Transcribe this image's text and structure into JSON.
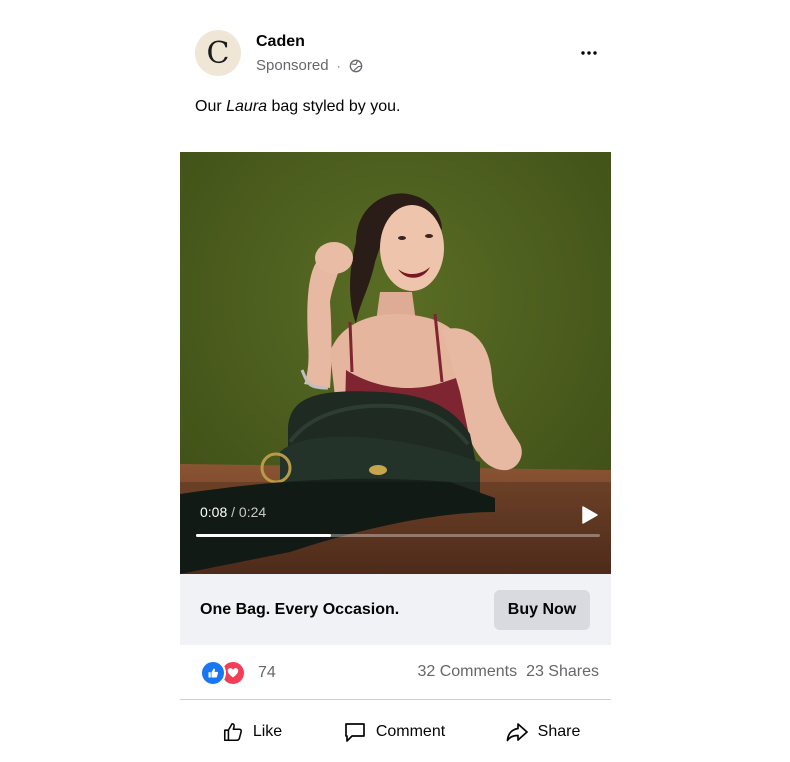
{
  "post": {
    "avatar_letter": "C",
    "page_name": "Caden",
    "sponsored": "Sponsored",
    "separator": "·",
    "more_label": "···",
    "caption_before": "Our ",
    "caption_italic": "Laura",
    "caption_after": " bag styled by you."
  },
  "video": {
    "current_time": "0:08",
    "time_separator": " / ",
    "duration": "0:24",
    "progress_fraction": 0.333,
    "background_color": "#4c5e1e"
  },
  "cta": {
    "headline": "One Bag. Every Occasion.",
    "button_label": "Buy Now"
  },
  "engagement": {
    "reaction_count": "74",
    "comments": "32 Comments",
    "shares": "23 Shares"
  },
  "actions": {
    "like": "Like",
    "comment": "Comment",
    "share": "Share"
  },
  "colors": {
    "like_blue": "#1877f2",
    "love_red": "#f33e58",
    "secondary_text": "#65676b",
    "cta_background": "#f0f2f5"
  },
  "icons": [
    "globe-icon",
    "more-icon",
    "play-icon",
    "like-reaction-icon",
    "love-reaction-icon",
    "thumbs-up-icon",
    "comment-icon",
    "share-icon"
  ]
}
